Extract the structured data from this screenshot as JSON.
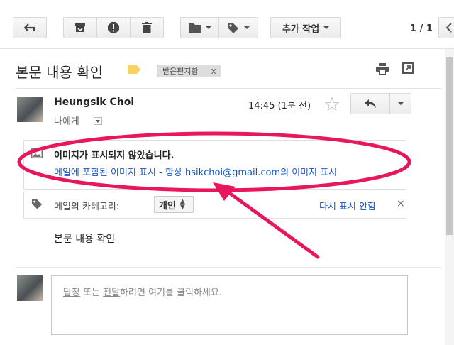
{
  "toolbar": {
    "more_actions_label": "추가 작업",
    "page_counter": "1 / 1",
    "icons": [
      "back-arrow-icon",
      "archive-icon",
      "report-spam-icon",
      "delete-icon",
      "folder-icon",
      "label-icon",
      "chevron-left-icon"
    ]
  },
  "message": {
    "subject": "본문 내용 확인",
    "label_chip": "받은편지함",
    "label_chip_remove": "x",
    "sender_name": "Heungsik Choi",
    "recipient": "나에게",
    "time": "14:45 (1분 전)",
    "body": "본문 내용 확인"
  },
  "images_notice": {
    "title": "이미지가 표시되지 않았습니다.",
    "show_images_link": "메일에 포함된 이미지 표시",
    "separator": " - ",
    "always_show_link": "항상 hsikchoi@gmail.com의 이미지 표시"
  },
  "category_bar": {
    "label": "메일의 카테고리:",
    "selected": "개인",
    "dont_show_again": "다시 표시 안함",
    "close": "×"
  },
  "reply": {
    "reply_link": "답장",
    "or_text": " 또는 ",
    "forward_link": "전달",
    "suffix": "하려면 여기를 클릭하세요."
  },
  "colors": {
    "link": "#1155cc",
    "annotation": "#e8175d",
    "label_folder": "#fad165"
  }
}
